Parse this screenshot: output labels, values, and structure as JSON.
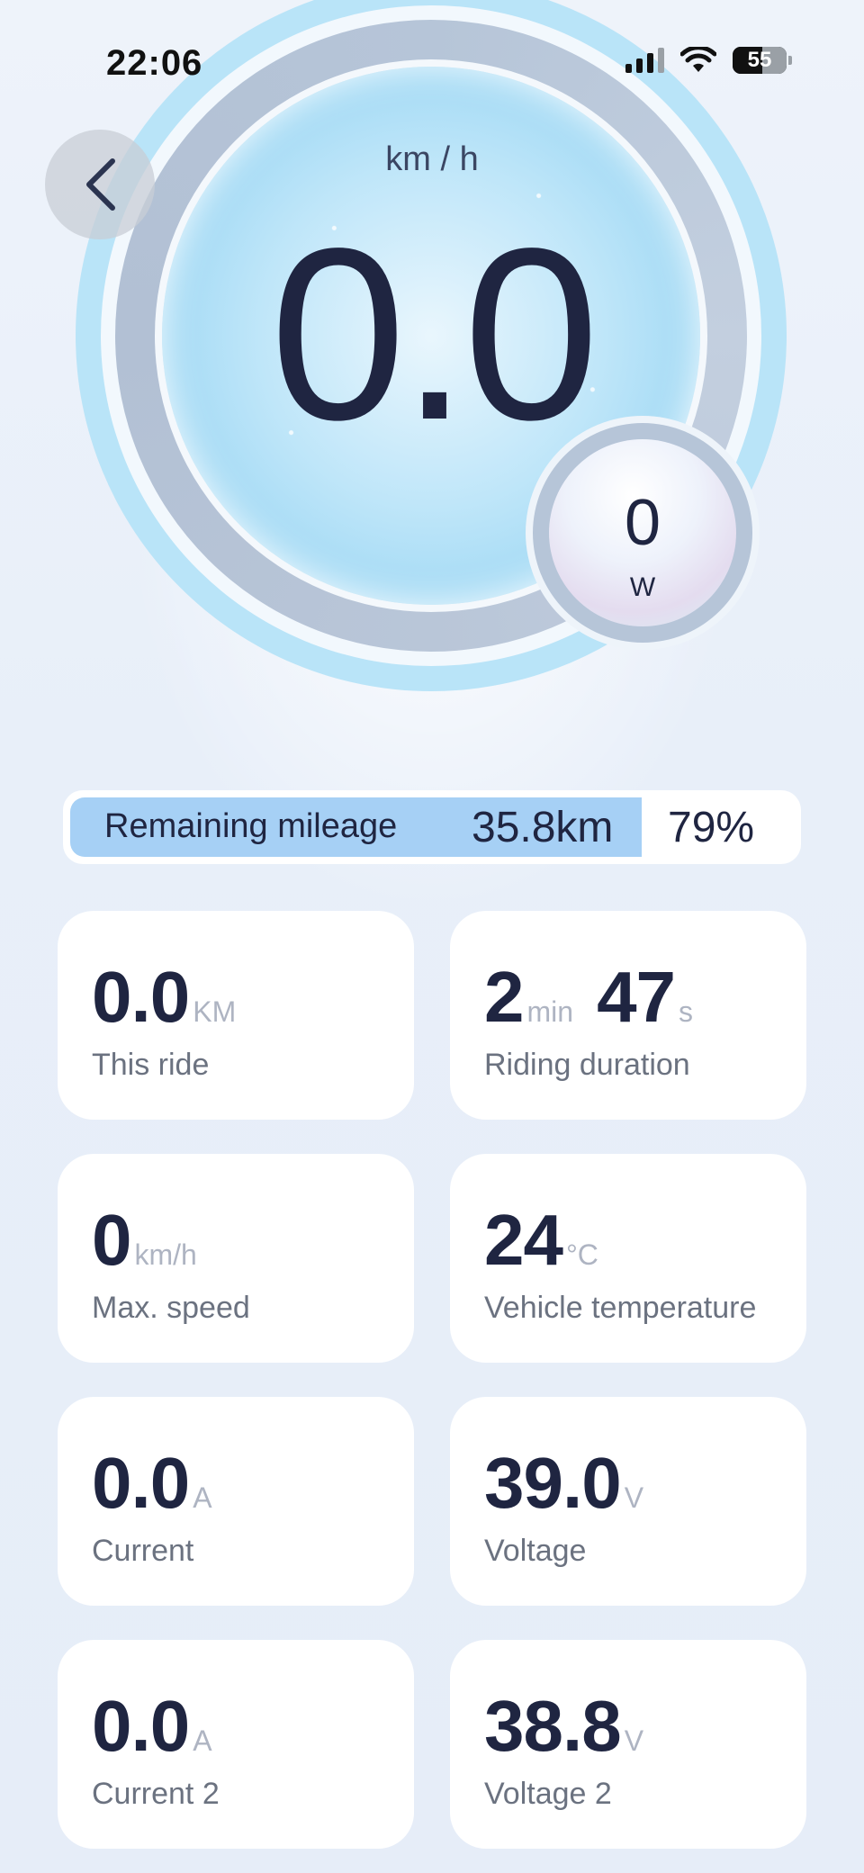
{
  "status_bar": {
    "time": "22:06",
    "battery_level": "55",
    "icons": [
      "cellular-signal-icon",
      "wifi-icon",
      "battery-icon"
    ]
  },
  "speedometer": {
    "unit": "km / h",
    "speed": "0.0",
    "power_value": "0",
    "power_unit": "W"
  },
  "remaining_mileage": {
    "label": "Remaining mileage",
    "distance": "35.8km",
    "percent_text": "79%",
    "percent": 79
  },
  "stats": [
    {
      "value": "0.0",
      "unit": "KM",
      "label": "This ride"
    },
    {
      "value": "2",
      "unit": "min",
      "value2": "47",
      "unit2": "s",
      "label": "Riding duration"
    },
    {
      "value": "0",
      "unit": "km/h",
      "label": "Max. speed"
    },
    {
      "value": "24",
      "unit": "°C",
      "label": "Vehicle temperature"
    },
    {
      "value": "0.0",
      "unit": "A",
      "label": "Current"
    },
    {
      "value": "39.0",
      "unit": "V",
      "label": "Voltage"
    },
    {
      "value": "0.0",
      "unit": "A",
      "label": "Current 2"
    },
    {
      "value": "38.8",
      "unit": "V",
      "label": "Voltage 2"
    }
  ],
  "colors": {
    "accent_light_blue": "#b9e4f8",
    "progress_fill": "#a6d0f5",
    "text_dark": "#1f2541",
    "unit_gray": "#aeb4c2"
  }
}
